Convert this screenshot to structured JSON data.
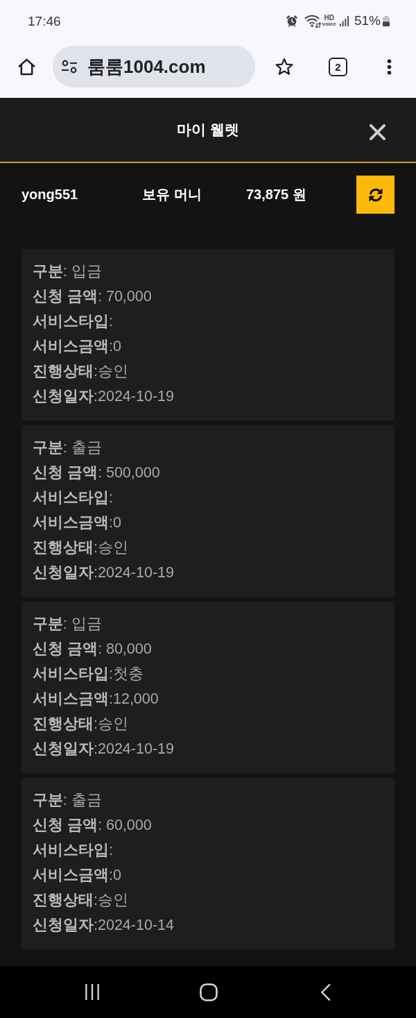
{
  "status_bar": {
    "time": "17:46",
    "hd_voice": {
      "top": "HD",
      "bottom": "voice"
    },
    "battery": "51%"
  },
  "browser": {
    "url": "룸룸1004.com",
    "tab_count": "2"
  },
  "dialog": {
    "title": "마이 웰렛",
    "wallet": {
      "username": "yong551",
      "balance_label": "보유 머니",
      "balance": "73,875 원"
    },
    "transactions": [
      {
        "lines": [
          "**구분**: 입금",
          "**신청 금액**: 70,000",
          "**서비스타입**:",
          "**서비스금액**:0",
          "**진행상태**:승인",
          "**신청일자**:2024-10-19"
        ]
      },
      {
        "lines": [
          "**구분**: 출금",
          "**신청 금액**: 500,000",
          "**서비스타입**:",
          "**서비스금액**:0",
          "**진행상태**:승인",
          "**신청일자**:2024-10-19"
        ]
      },
      {
        "lines": [
          "**구분**: 입금",
          "**신청 금액**: 80,000",
          "**서비스타입**:첫충",
          "**서비스금액**:12,000",
          "**진행상태**:승인",
          "**신청일자**:2024-10-19"
        ]
      },
      {
        "lines": [
          "**구분**: 출금",
          "**신청 금액**: 60,000",
          "**서비스타입**:",
          "**서비스금액**:0",
          "**진행상태**:승인",
          "**신청일자**:2024-10-14"
        ]
      }
    ]
  }
}
